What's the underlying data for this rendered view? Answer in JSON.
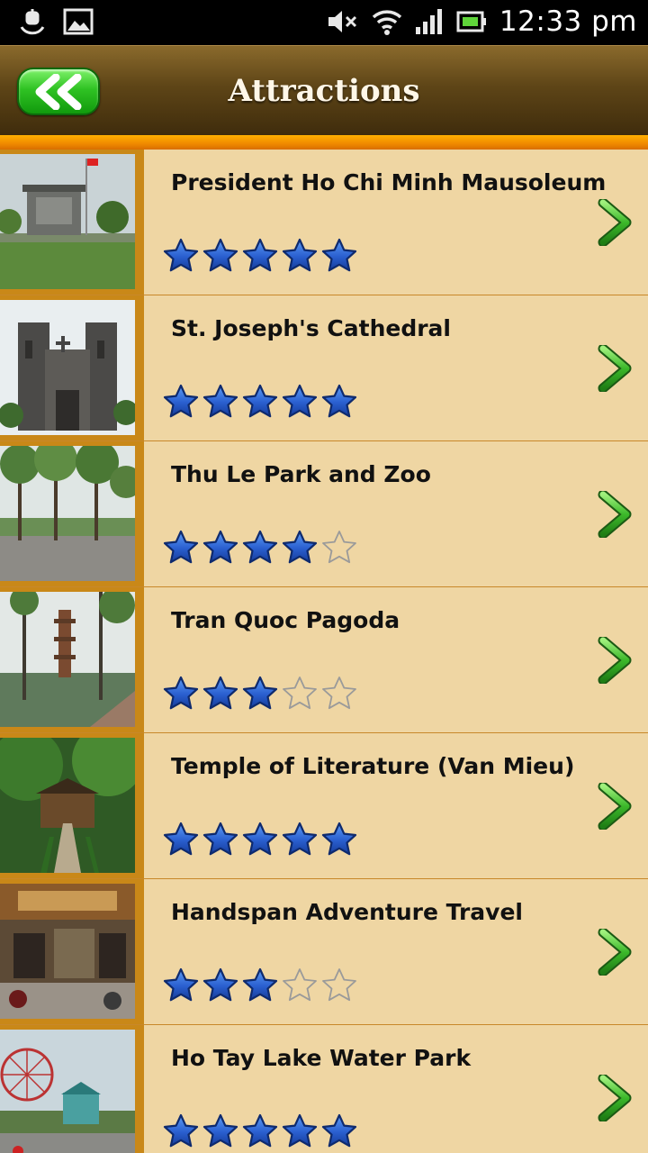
{
  "status_bar": {
    "time": "12:33 pm",
    "icons": [
      "usb-debug-icon",
      "picture-icon",
      "mute-icon",
      "wifi-icon",
      "signal-icon",
      "battery-icon"
    ]
  },
  "header": {
    "title": "Attractions",
    "back_icon": "double-chevron-left-icon"
  },
  "colors": {
    "header_top": "#8a6a2c",
    "header_bottom": "#3f2c0c",
    "accent": "#f08a00",
    "row_bg": "#efd6a3",
    "star_filled": "#2a5fcf",
    "back_button": "#2fc223",
    "chevron": "#3cb82a"
  },
  "attractions": [
    {
      "name": "President Ho Chi Minh Mausoleum",
      "rating": 5,
      "rating_max": 5
    },
    {
      "name": "St. Joseph's Cathedral",
      "rating": 5,
      "rating_max": 5
    },
    {
      "name": "Thu Le Park and Zoo",
      "rating": 4,
      "rating_max": 5
    },
    {
      "name": "Tran Quoc Pagoda",
      "rating": 3,
      "rating_max": 5
    },
    {
      "name": "Temple of Literature (Van Mieu)",
      "rating": 5,
      "rating_max": 5
    },
    {
      "name": "Handspan Adventure Travel",
      "rating": 3,
      "rating_max": 5
    },
    {
      "name": "Ho Tay Lake Water Park",
      "rating": 5,
      "rating_max": 5
    }
  ]
}
